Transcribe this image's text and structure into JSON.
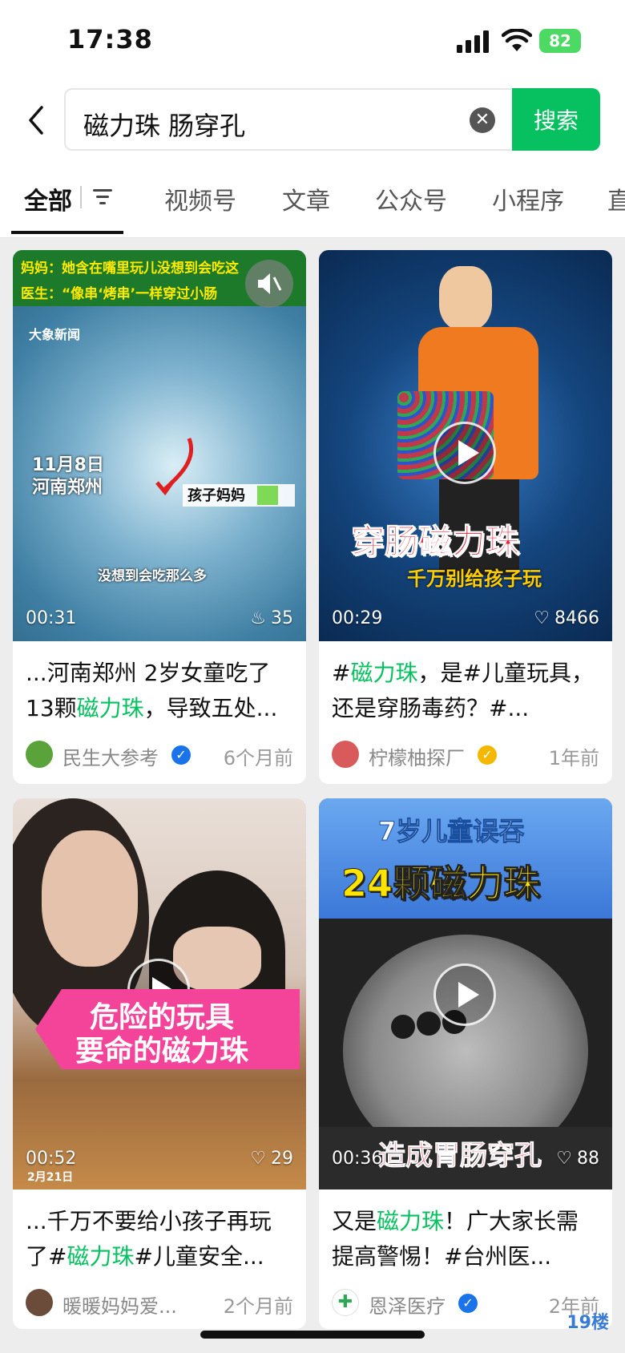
{
  "status_bar": {
    "time": "17:38",
    "battery": "82"
  },
  "search": {
    "query": "磁力珠 肠穿孔",
    "button_label": "搜索"
  },
  "tabs": [
    "全部",
    "视频号",
    "文章",
    "公众号",
    "小程序",
    "直"
  ],
  "cards": [
    {
      "duration": "00:31",
      "count": "35",
      "count_icon": "fire-icon",
      "overlay": {
        "line1": "妈妈：她含在嘴里玩儿没想到会吃这",
        "line2": "医生：“像串‘烤串’一样穿过小肠",
        "date": "11月8日",
        "place": "河南郑州",
        "label": "孩子妈妈",
        "caption": "没想到会吃那么多",
        "logo": "大象新闻"
      },
      "title_parts": [
        "...河南郑州 2岁女童吃了13颗",
        "磁力珠",
        "，导致五处..."
      ],
      "author": "民生大参考",
      "verified_color": "#1a73e8",
      "time": "6个月前"
    },
    {
      "duration": "00:29",
      "count": "8466",
      "count_icon": "heart-icon",
      "overlay": {
        "big": "穿肠磁力珠",
        "small": "千万别给孩子玩"
      },
      "title_parts": [
        "#",
        "磁力珠",
        "，是#儿童玩具，还是穿肠毒药？#..."
      ],
      "author": "柠檬柚探厂",
      "verified_color": "#f5b800",
      "time": "1年前"
    },
    {
      "duration": "00:52",
      "count": "29",
      "count_icon": "heart-icon",
      "overlay": {
        "line1": "危险的玩具",
        "line2": "要命的磁力珠",
        "date": "2月21日"
      },
      "title_parts": [
        "...千万不要给小孩子再玩了#",
        "磁力珠",
        "#儿童安全..."
      ],
      "author": "暖暖妈妈爱...",
      "verified_color": "",
      "time": "2个月前"
    },
    {
      "duration": "00:36",
      "count": "88",
      "count_icon": "heart-icon",
      "overlay": {
        "top": "7岁儿童误吞",
        "big": "24颗磁力珠",
        "bottom": "造成胃肠穿孔"
      },
      "title_parts": [
        "又是",
        "磁力珠",
        "！广大家长需提高警惕！#台州医..."
      ],
      "author": "恩泽医疗",
      "verified_color": "#1a73e8",
      "time": "2年前"
    }
  ],
  "watermark": "19楼"
}
